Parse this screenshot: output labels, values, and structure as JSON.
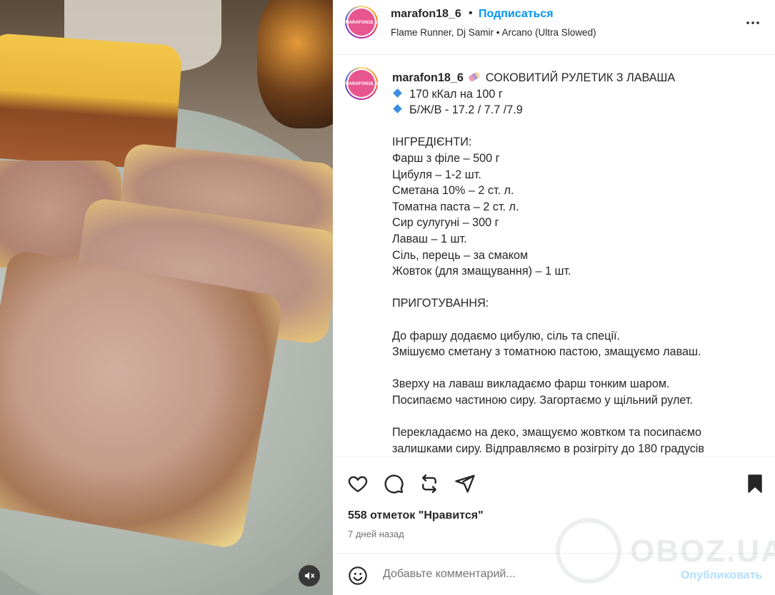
{
  "media": {
    "mute_icon": "speaker-muted-icon"
  },
  "header": {
    "username": "marafon18_6",
    "separator": "•",
    "follow_label": "Подписаться",
    "audio": "Flame Runner, Dj Samir • Arcano (Ultra Slowed)",
    "avatar_text": "MARAFON18_6",
    "more_icon": "more-icon"
  },
  "caption": {
    "username": "marafon18_6",
    "title": "СОКОВИТИЙ РУЛЕТИК З ЛАВАША",
    "calories": "170 кКал на 100 г",
    "macros": "Б/Ж/В - 17.2 / 7.7 /7.9",
    "ingredients_header": "ІНГРЕДІЄНТИ:",
    "ingredients": [
      "Фарш з філе – 500 г",
      "Цибуля – 1-2 шт.",
      "Сметана 10% – 2 ст. л.",
      "Томатна паста – 2 ст. л.",
      "Сир сулугуні – 300 г",
      "Лаваш – 1 шт.",
      "Сіль, перець – за смаком",
      "Жовток (для змащування) – 1 шт."
    ],
    "prep_header": "ПРИГОТУВАННЯ:",
    "steps": [
      "До фаршу додаємо цибулю, сіль та спеції.",
      "Змішуємо сметану з томатною пастою, змащуємо лаваш.",
      "Зверху на лаваш викладаємо фарш тонким шаром.",
      "Посипаємо частиною сиру. Загортаємо у щільний рулет.",
      "Перекладаємо на деко, змащуємо жовтком та посипаємо",
      "залишками сиру. Відправляємо в розігріту до 180 градусів"
    ]
  },
  "actions": {
    "likes": "558 отметок \"Нравится\"",
    "time": "7 дней назад"
  },
  "comment": {
    "placeholder": "Добавьте комментарий...",
    "post_label": "Опубликовать"
  },
  "watermark": {
    "text": "OBOZ.UA"
  }
}
